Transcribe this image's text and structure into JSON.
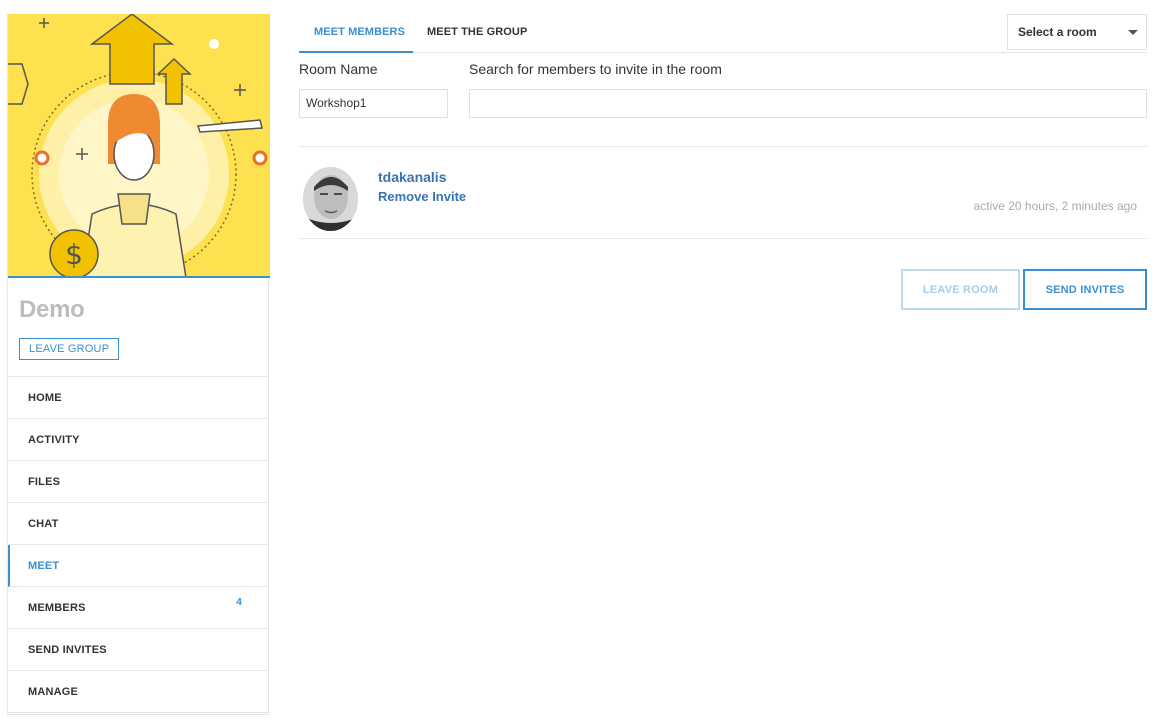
{
  "group": {
    "name": "Demo",
    "leave_label": "LEAVE GROUP"
  },
  "nav": {
    "items": [
      {
        "label": "HOME"
      },
      {
        "label": "ACTIVITY"
      },
      {
        "label": "FILES"
      },
      {
        "label": "CHAT"
      },
      {
        "label": "MEET",
        "active": true
      },
      {
        "label": "MEMBERS",
        "count": "4"
      },
      {
        "label": "SEND INVITES"
      },
      {
        "label": "MANAGE"
      }
    ]
  },
  "tabs": [
    {
      "label": "MEET MEMBERS",
      "active": true
    },
    {
      "label": "MEET THE GROUP"
    }
  ],
  "room_select": {
    "value": "Select a room"
  },
  "form": {
    "room_name_label": "Room Name",
    "room_name_value": "Workshop1",
    "search_label": "Search for members to invite in the room",
    "search_value": ""
  },
  "member": {
    "name": "tdakanalis",
    "action": "Remove Invite",
    "last_active": "active 20 hours, 2 minutes ago"
  },
  "buttons": {
    "leave_room": "LEAVE ROOM",
    "send_invites": "SEND INVITES"
  },
  "colors": {
    "accent": "#3a8fd0",
    "link": "#3a74ad",
    "cover_bg": "#fde14f"
  },
  "icons": {
    "cover": "group-cover-illustration",
    "dropdown": "chevron-down-icon",
    "avatar": "user-avatar"
  }
}
